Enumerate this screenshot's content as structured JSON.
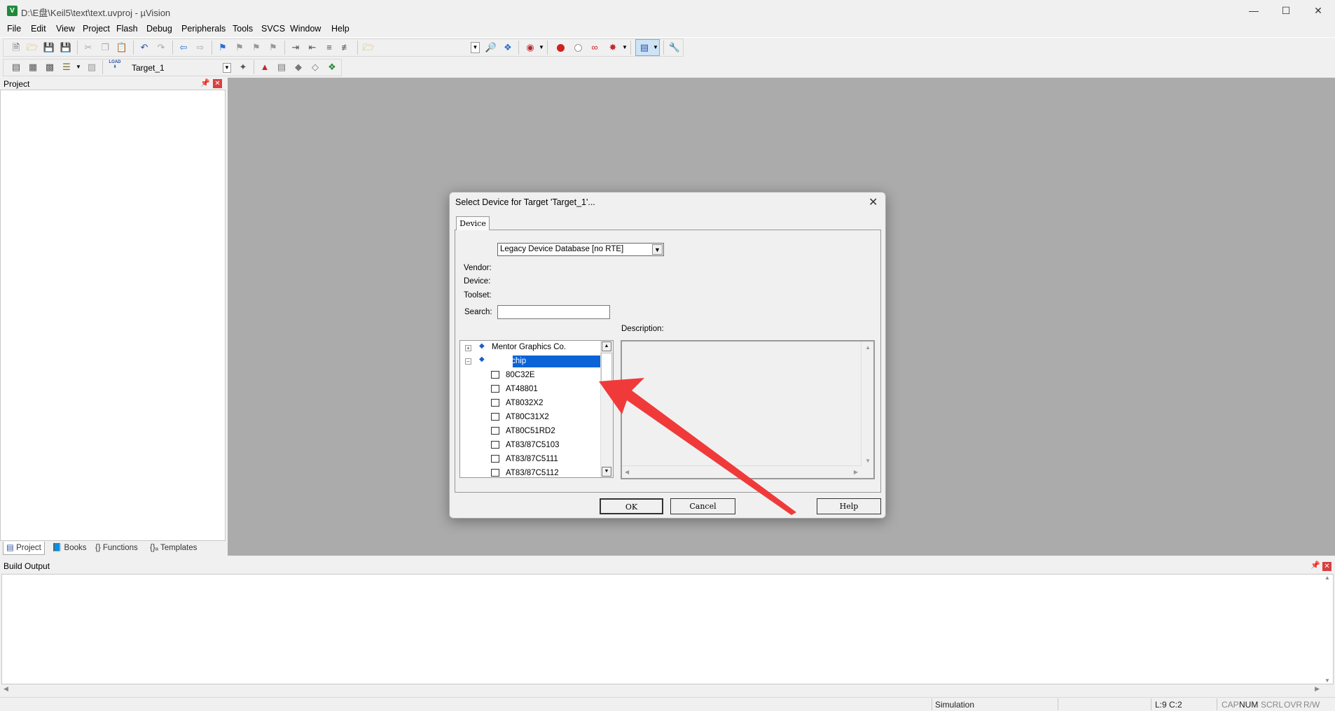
{
  "window": {
    "title": "D:\\E盘\\Keil5\\text\\text.uvproj - µVision",
    "app_icon_letter": "V"
  },
  "menu": [
    "File",
    "Edit",
    "View",
    "Project",
    "Flash",
    "Debug",
    "Peripherals",
    "Tools",
    "SVCS",
    "Window",
    "Help"
  ],
  "toolbar2": {
    "load_label": "LOAD",
    "target": "Target_1"
  },
  "project_panel": {
    "title": "Project",
    "tabs": [
      "Project",
      "Books",
      "{} Functions",
      "{}ₐ Templates"
    ]
  },
  "build_output": {
    "title": "Build Output"
  },
  "statusbar": {
    "mode": "Simulation",
    "position": "L:9 C:2",
    "cap": "CAP",
    "num": "NUM",
    "scrl": "SCRL",
    "ovr": "OVR",
    "rw": "R/W"
  },
  "dialog": {
    "title": "Select Device for Target 'Target_1'...",
    "tab": "Device",
    "database": "Legacy Device Database [no RTE]",
    "vendor_label": "Vendor:",
    "device_label": "Device:",
    "toolset_label": "Toolset:",
    "search_label": "Search:",
    "search_value": "",
    "description_label": "Description:",
    "tree": {
      "vendors": [
        "Mentor Graphics Co.",
        "Microchip"
      ],
      "selected": "Microchip",
      "devices": [
        "80C32E",
        "AT48801",
        "AT8032X2",
        "AT80C31X2",
        "AT80C51RD2",
        "AT83/87C5103",
        "AT83/87C5111",
        "AT83/87C5112"
      ]
    },
    "buttons": {
      "ok": "OK",
      "cancel": "Cancel",
      "help": "Help"
    }
  },
  "colors": {
    "selection": "#0a64d8",
    "arrow": "#f03a3a",
    "mdi_background": "#ababab"
  }
}
